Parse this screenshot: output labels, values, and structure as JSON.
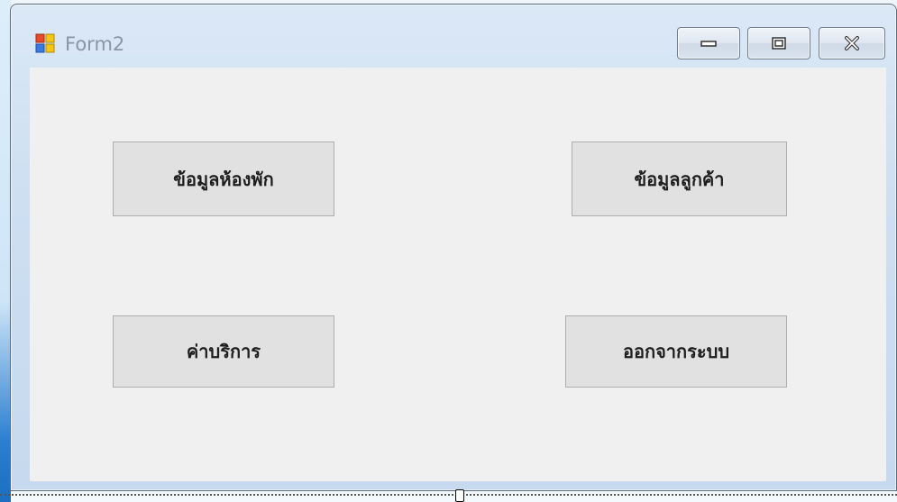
{
  "window": {
    "title": "Form2",
    "icon": "winforms-form-icon",
    "controls": {
      "minimize": "minimize-icon",
      "maximize": "maximize-icon",
      "close": "close-icon"
    }
  },
  "form": {
    "buttons": {
      "room_info": "ข้อมูลห้องพัก",
      "customer_info": "ข้อมูลลูกค้า",
      "service_charges": "ค่าบริการ",
      "logout": "ออกจากระบบ"
    }
  },
  "colors": {
    "form_background": "#f0f0f0",
    "button_background": "#e1e1e1",
    "title_text": "#8a96a3"
  }
}
